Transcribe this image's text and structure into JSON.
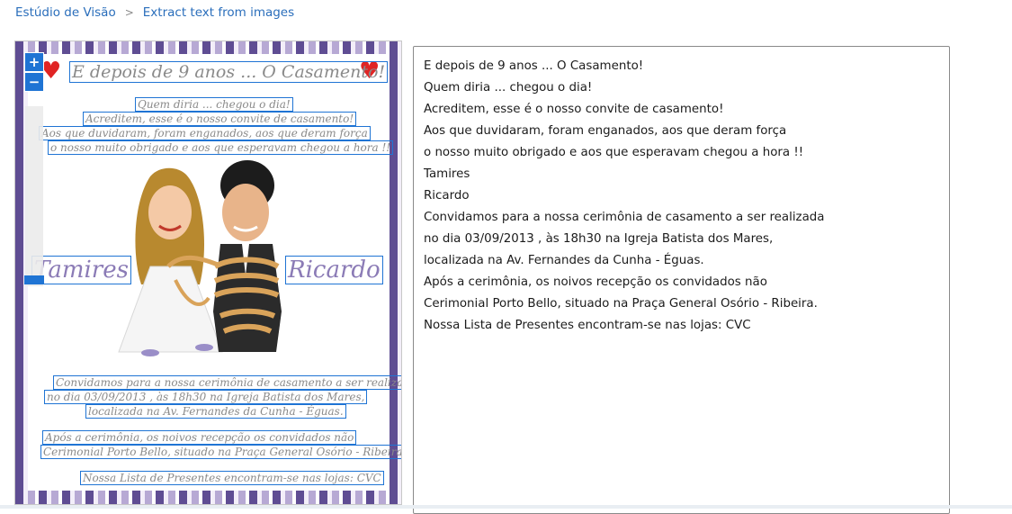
{
  "breadcrumb": {
    "root": "Estúdio de Visão",
    "current": "Extract text from images"
  },
  "zoom": {
    "in_label": "+",
    "out_label": "−"
  },
  "image": {
    "ocr_title": "E depois de 9 anos ... O Casamento!",
    "ocr_lines": [
      "Quem diria ... chegou o dia!",
      "Acreditem, esse é o nosso convite de casamento!",
      "Aos que duvidaram, foram enganados, aos que deram força",
      "o nosso muito obrigado e aos que esperavam chegou a hora !!"
    ],
    "bride_name": "Tamires",
    "groom_name": "Ricardo",
    "ocr_lines_bottom": [
      "Convidamos para a nossa cerimônia de casamento a ser realizada",
      "no dia 03/09/2013 , às 18h30 na Igreja Batista dos Mares,",
      "localizada na Av. Fernandes da Cunha - Éguas.",
      "Após a cerimônia, os noivos recepção os convidados não",
      "Cerimonial Porto Bello, situado na Praça General Osório - Ribeira.",
      "Nossa Lista de Presentes encontram-se nas lojas: CVC"
    ]
  },
  "extracted_text": {
    "lines": [
      "E depois de 9 anos ... O Casamento!",
      "Quem diria ... chegou o dia!",
      "Acreditem, esse é o nosso convite de casamento!",
      "Aos que duvidaram, foram enganados, aos que deram força",
      "o nosso muito obrigado e aos que esperavam chegou a hora !!",
      "Tamires",
      "Ricardo",
      "Convidamos para a nossa cerimônia de casamento a ser realizada",
      "no dia 03/09/2013 , às 18h30 na Igreja Batista dos Mares,",
      "localizada na Av. Fernandes da Cunha - Éguas.",
      "Após a cerimônia, os noivos recepção os convidados não",
      "Cerimonial Porto Bello, situado na Praça General Osório - Ribeira.",
      "Nossa Lista de Presentes encontram-se nas lojas: CVC"
    ]
  },
  "colors": {
    "accent": "#1f74d4",
    "link": "#2a6ebb",
    "heart": "#e02424"
  }
}
